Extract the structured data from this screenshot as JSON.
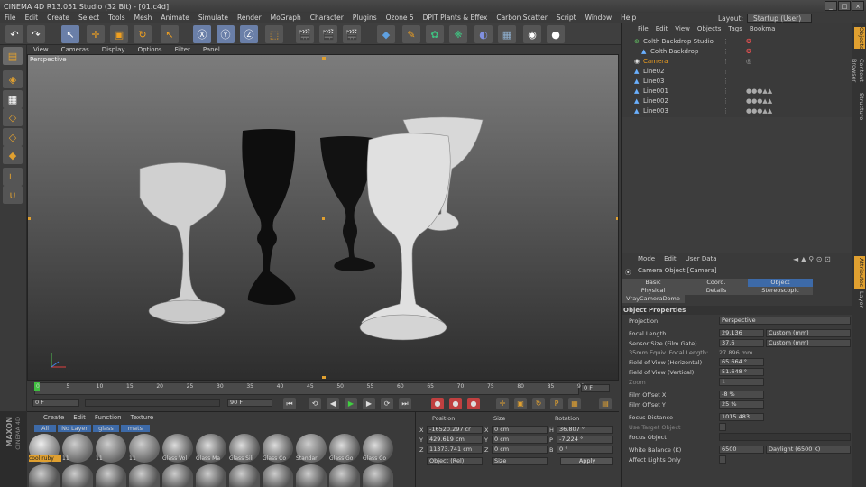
{
  "window": {
    "title": "CINEMA 4D R13.051 Studio (32 Bit) - [01.c4d]"
  },
  "menu": [
    "File",
    "Edit",
    "Create",
    "Select",
    "Tools",
    "Mesh",
    "Animate",
    "Simulate",
    "Render",
    "MoGraph",
    "Character",
    "Plugins",
    "Ozone 5",
    "DPIT Plants & Effex",
    "Carbon Scatter",
    "Script",
    "Window",
    "Help"
  ],
  "layout": {
    "label": "Layout:",
    "value": "Startup (User)"
  },
  "viewport_menu": [
    "View",
    "Cameras",
    "Display",
    "Options",
    "Filter",
    "Panel"
  ],
  "viewport": {
    "label": "Perspective"
  },
  "objects_menu": [
    "File",
    "Edit",
    "View",
    "Objects",
    "Tags",
    "Bookma"
  ],
  "objects": [
    {
      "name": "Colth Backdrop Studio",
      "indent": 0,
      "icon": "null-icon",
      "highlight": false
    },
    {
      "name": "Colth Backdrop",
      "indent": 1,
      "icon": "backdrop-icon",
      "highlight": false
    },
    {
      "name": "Camera",
      "indent": 0,
      "icon": "camera-icon",
      "highlight": true
    },
    {
      "name": "Line02",
      "indent": 0,
      "icon": "lathe-icon",
      "highlight": false
    },
    {
      "name": "Line03",
      "indent": 0,
      "icon": "lathe-icon",
      "highlight": false
    },
    {
      "name": "Line001",
      "indent": 0,
      "icon": "lathe-icon",
      "highlight": false
    },
    {
      "name": "Line002",
      "indent": 0,
      "icon": "lathe-icon",
      "highlight": false
    },
    {
      "name": "Line003",
      "indent": 0,
      "icon": "lathe-icon",
      "highlight": false
    }
  ],
  "attributes": {
    "menu": [
      "Mode",
      "Edit",
      "User Data"
    ],
    "object_title": "Camera Object [Camera]",
    "tabs": [
      {
        "label": "Basic",
        "active": false
      },
      {
        "label": "Coord.",
        "active": false
      },
      {
        "label": "Object",
        "active": true
      },
      {
        "label": "Physical",
        "active": false
      },
      {
        "label": "Details",
        "active": false
      },
      {
        "label": "Stereoscopic",
        "active": false
      },
      {
        "label": "VrayCameraDome",
        "active": false
      }
    ],
    "section": "Object Properties",
    "projection": {
      "label": "Projection",
      "value": "Perspective"
    },
    "focal_length": {
      "label": "Focal Length",
      "value": "29.136",
      "preset": "Custom (mm)"
    },
    "sensor_size": {
      "label": "Sensor Size (Film Gate)",
      "value": "37.6",
      "preset": "Custom (mm)"
    },
    "equiv_focal": {
      "label": "35mm Equiv. Focal Length:",
      "value": "27.896 mm"
    },
    "fov_h": {
      "label": "Field of View (Horizontal)",
      "value": "65.664 °"
    },
    "fov_v": {
      "label": "Field of View (Vertical)",
      "value": "51.648 °"
    },
    "zoom": {
      "label": "Zoom",
      "value": "1"
    },
    "film_offset_x": {
      "label": "Film Offset X",
      "value": "-8 %"
    },
    "film_offset_y": {
      "label": "Film Offset Y",
      "value": "25 %"
    },
    "focus_distance": {
      "label": "Focus Distance",
      "value": "1015.483"
    },
    "use_target": {
      "label": "Use Target Object"
    },
    "focus_object": {
      "label": "Focus Object"
    },
    "white_balance": {
      "label": "White Balance (K)",
      "value": "6500",
      "preset": "Daylight (6500 K)"
    },
    "affect_lights": {
      "label": "Affect Lights Only"
    }
  },
  "timeline": {
    "ticks": [
      "0",
      "5",
      "10",
      "15",
      "20",
      "25",
      "30",
      "35",
      "40",
      "45",
      "50",
      "55",
      "60",
      "65",
      "70",
      "75",
      "80",
      "85",
      "90"
    ],
    "end_frame": "0 F",
    "current_frame": "0 F",
    "start_field": "0 F",
    "end_field": "90 F"
  },
  "materials": {
    "menu": [
      "Create",
      "Edit",
      "Function",
      "Texture"
    ],
    "filters": [
      "All",
      "No Layer",
      "glass",
      "mats"
    ],
    "row1": [
      "cool ruby",
      "11",
      "11",
      "11",
      "Glass Vol",
      "Glass Ma",
      "Glass Sili",
      "Glass Co",
      "Standar",
      "Glass Go",
      "Glass Co"
    ]
  },
  "coordinates": {
    "headers": [
      "Position",
      "Size",
      "Rotation"
    ],
    "rows": [
      {
        "axis": "X",
        "pos": "-16520.297 cr",
        "size": "0 cm",
        "rot_axis": "H",
        "rot": "36.807 °"
      },
      {
        "axis": "Y",
        "pos": "429.619 cm",
        "size": "0 cm",
        "rot_axis": "P",
        "rot": "-7.224 °"
      },
      {
        "axis": "Z",
        "pos": "11373.741 cm",
        "size": "0 cm",
        "rot_axis": "B",
        "rot": "0 °"
      }
    ],
    "mode": "Object (Rel)",
    "size_mode": "Size",
    "apply": "Apply"
  },
  "branding": {
    "line1": "MAXON",
    "line2": "CINEMA 4D"
  },
  "right_tabs": [
    "Objects",
    "Content Browser",
    "Structure"
  ],
  "attr_right_tabs": [
    "Attributes",
    "Layer"
  ],
  "colors": {
    "accent_orange": "#e0a030",
    "highlight_blue": "#3d6aa8",
    "camera_orange": "#f0a020"
  }
}
